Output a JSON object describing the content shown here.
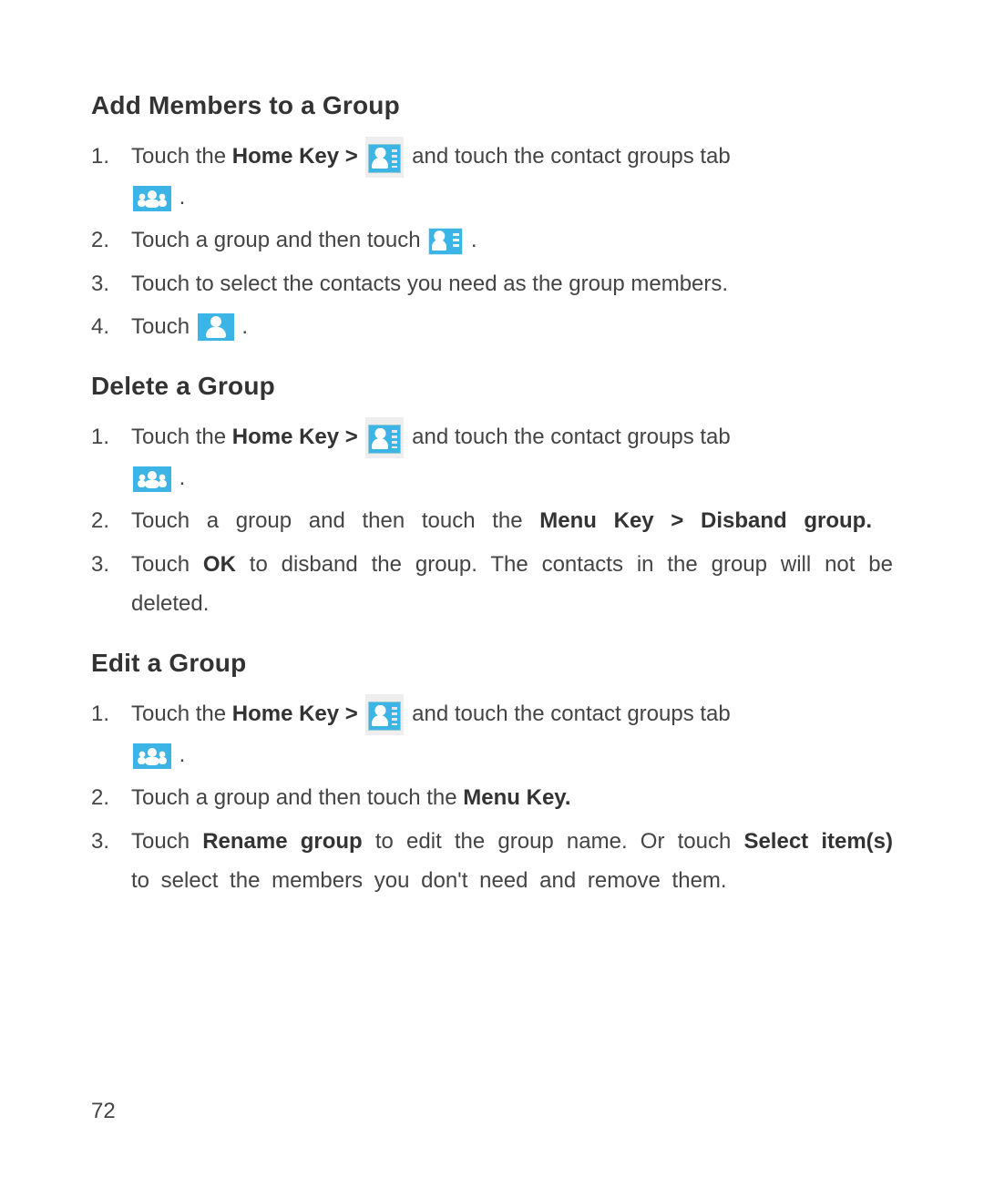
{
  "page_number": "72",
  "sections": [
    {
      "id": "add",
      "heading": "Add Members to a Group",
      "steps": {
        "s1": {
          "num": "1.",
          "t1": "Touch the ",
          "bold1": "Home Key > ",
          "t2": " and touch the contact groups tab ",
          "t3": "."
        },
        "s2": {
          "num": "2.",
          "t1": "Touch a group and then touch ",
          "t2": "."
        },
        "s3": {
          "num": "3.",
          "t1": "Touch to select the contacts you need as the group members."
        },
        "s4": {
          "num": "4.",
          "t1": "Touch ",
          "t2": "."
        }
      }
    },
    {
      "id": "delete",
      "heading": "Delete a Group",
      "steps": {
        "s1": {
          "num": "1.",
          "t1": "Touch the ",
          "bold1": "Home Key > ",
          "t2": "  and touch the contact groups tab ",
          "t3": "."
        },
        "s2": {
          "num": "2.",
          "t1": "Touch a group and then touch the ",
          "bold1": "Menu Key > Disband group."
        },
        "s3": {
          "num": "3.",
          "t1": "Touch ",
          "bold1": "OK",
          "t2": " to disband the group. The contacts in the group will not be deleted."
        }
      }
    },
    {
      "id": "edit",
      "heading": "Edit a Group",
      "steps": {
        "s1": {
          "num": "1.",
          "t1": "Touch the ",
          "bold1": "Home Key > ",
          "t2": " and touch the contact groups tab ",
          "t3": "."
        },
        "s2": {
          "num": "2.",
          "t1": "Touch a group and then touch the ",
          "bold1": "Menu Key."
        },
        "s3": {
          "num": "3.",
          "t1": "Touch ",
          "bold1": "Rename group",
          "t2": " to edit the group name. Or touch ",
          "bold2": "Select item(s)",
          "t3": " to select the members you don't need and remove them."
        }
      }
    }
  ],
  "icons": {
    "contacts_app": "contacts-app-icon",
    "groups_tab": "groups-tab-icon",
    "add_contact": "add-contact-icon",
    "contact_single": "contact-single-icon"
  }
}
